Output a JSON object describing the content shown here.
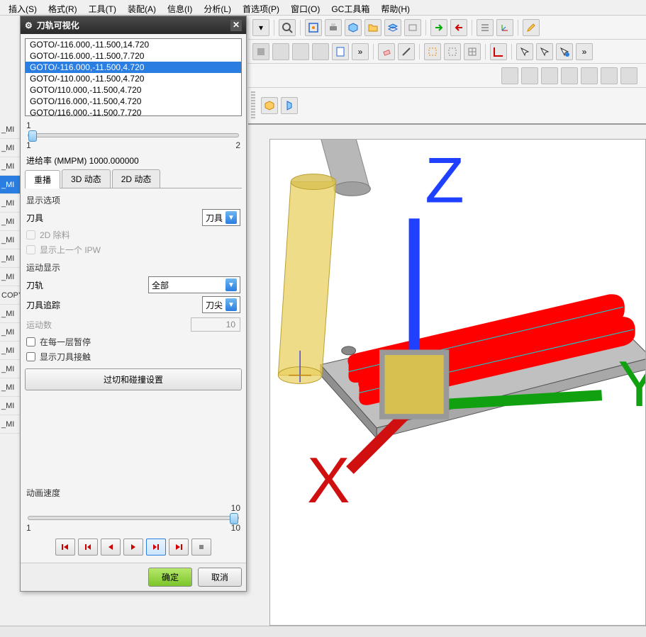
{
  "menu": {
    "items": [
      "插入(S)",
      "格式(R)",
      "工具(T)",
      "装配(A)",
      "信息(I)",
      "分析(L)",
      "首选项(P)",
      "窗口(O)",
      "GC工具箱",
      "帮助(H)"
    ]
  },
  "dialog": {
    "title": "刀轨可视化",
    "list_items": [
      "GOTO/-116.000,-11.500,14.720",
      "GOTO/-116.000,-11.500,7.720",
      "GOTO/-116.000,-11.500,4.720",
      "GOTO/-110.000,-11.500,4.720",
      "GOTO/110.000,-11.500,4.720",
      "GOTO/116.000,-11.500,4.720",
      "GOTO/116.000,-11.500,7.720"
    ],
    "list_selected_index": 2,
    "slider1": {
      "top_label": "1",
      "min": "1",
      "max": "2"
    },
    "feedrate_label": "进给率 (MMPM) 1000.000000",
    "tabs": [
      "重播",
      "3D 动态",
      "2D 动态"
    ],
    "active_tab": 0,
    "display_options_label": "显示选项",
    "tool_label": "刀具",
    "tool_value": "刀具",
    "chk_2d_remove": "2D 除料",
    "chk_show_prev_ipw": "显示上一个 IPW",
    "motion_display_label": "运动显示",
    "toolpath_label": "刀轨",
    "toolpath_value": "全部",
    "tooltrack_label": "刀具追踪",
    "tooltrack_value": "刀尖",
    "motion_count_label": "运动数",
    "motion_count_value": "10",
    "chk_pause_each_layer": "在每一层暂停",
    "chk_show_tool_contact": "显示刀具接触",
    "gouge_btn": "过切和碰撞设置",
    "anim_speed_label": "动画速度",
    "anim_speed": {
      "top": "10",
      "min": "1",
      "max": "10"
    },
    "ok": "确定",
    "cancel": "取消"
  },
  "left_items": [
    "_MI",
    "_MI",
    "_MI",
    "_MI",
    "_MI",
    "_MI",
    "_MI",
    "_MI",
    "_MI",
    "COPY",
    "_MI",
    "_MI",
    "_MI",
    "_MI",
    "_MI",
    "_MI",
    "_MI"
  ],
  "left_selected_index": 3
}
